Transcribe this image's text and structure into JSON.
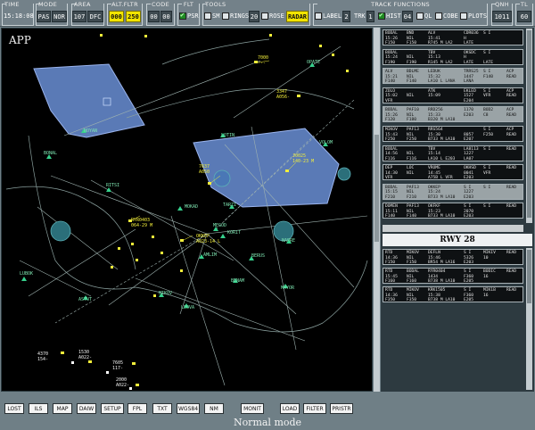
{
  "toolbar": {
    "groups": {
      "time": "TIME",
      "mode": "MODE",
      "area": "AREA",
      "alt_fltr": "ALT.FLTR",
      "code": "CODE",
      "flt": "FLT",
      "tools": "TOOLS",
      "track_functions": "TRACK FUNCTIONS",
      "qnh": "QNH",
      "tl": "TL"
    },
    "time_value": "15:18:08",
    "mode_buttons": [
      "PAS",
      "NOR"
    ],
    "area_values": [
      "107",
      "DFC"
    ],
    "alt_filter": [
      "000",
      "250"
    ],
    "code_values": [
      "00",
      "00"
    ],
    "flt_psr": "PSR",
    "tools": {
      "sm": "SM",
      "rings": "RINGS",
      "rings_value": "20",
      "rose": "ROSE",
      "radar": "RADAR"
    },
    "track": {
      "label": "LABEL",
      "label_value": "2",
      "trk": "TRK",
      "trk_value": "1",
      "hist": "HIST",
      "hist_value": "04",
      "ql": "QL",
      "cobe": "COBE",
      "plots": "PLOTS"
    },
    "qnh_value": "1011",
    "tl_value": "60"
  },
  "radar": {
    "title": "APP",
    "fixes": [
      "NOYAN",
      "BONAL",
      "RITSI",
      "MOKAD",
      "MEGOD",
      "KORIT",
      "AMLIM",
      "BERUS",
      "BENAM",
      "MAYOR",
      "LEOVA",
      "MIKOV",
      "ASTUT",
      "LUBOK",
      "LOTIN",
      "VOLOM",
      "TARZI",
      "NAPRE",
      "OPATE"
    ],
    "data_tags": [
      {
        "text": "7000\n---",
        "color": "yellow"
      },
      {
        "text": "3347\nA056-",
        "color": "yellow"
      },
      {
        "text": "J0025\n140-23 M",
        "color": "yellow"
      },
      {
        "text": "7637\nA050",
        "color": "yellow"
      },
      {
        "text": "RYR0403\n064-29 M",
        "color": "yellow"
      },
      {
        "text": "OKKEP\nA023-14 L",
        "color": "yellow"
      },
      {
        "text": "4370\n154-",
        "color": "yellow"
      },
      {
        "text": "1530\nA022-",
        "color": "yellow"
      },
      {
        "text": "7605\n117-",
        "color": "yellow"
      },
      {
        "text": "2000\nA022-",
        "color": "yellow"
      }
    ]
  },
  "strips": {
    "departures": [
      {
        "c1": "BODAL\n15:26\nF150",
        "c2": "BND\nNIL\nF150",
        "c3": "ALV\n15:41\nR745 M LA2",
        "c4": "CDR036\nH\nLATE",
        "c5": "S I\n\n ",
        "grey": false
      },
      {
        "c1": "BODAL\n15:24\nF190",
        "c2": "\nNIL\nF190",
        "c3": "TBV\n15:13\nR145 M LA2",
        "c4": "OKSDC\nH\nLATE",
        "c5": "S I\n\nLATE",
        "grey": false
      },
      {
        "c1": "ALV\n15:21\nF140",
        "c2": "BDLME\nNIL\nF140",
        "c3": "LEDUK\n15:32\nLA10 L LANA",
        "c4": "TRRS25\n1447\nLANA",
        "c5": "S I\nF140\n ",
        "act": "ACP\nREAD",
        "grey": true
      },
      {
        "c1": "ZOLO\n15:02\nVFR",
        "c2": "\nNIL\n ",
        "c3": "ATK\n15:09\n ",
        "c4": "EKLED\n1527\nE204",
        "c5": "S I\nVFR\n ",
        "act": "ACP\nREAD",
        "grey": false
      },
      {
        "c1": "BODAL\n15:26\nF120",
        "c2": "PAF10\nNIL\nF180",
        "c3": "RRD256\n15:33\nB320 M LA10",
        "c4": "1170\nE203",
        "c5": "BOD2\nC8\n ",
        "act": "ACP\nREAD",
        "grey": true
      },
      {
        "c1": "MIKOV\n15:43\nF250",
        "c2": "PAF13\nNIL\nF250",
        "c3": "RRS564\n15:30\nB733 M LA10",
        "c4": "\n8057\nE207",
        "c5": "S I\nF250\n ",
        "act": "ACP\nREAD",
        "grey": false
      },
      {
        "c1": "BODAL\n14:56\nF116",
        "c2": "\nNIL\nF116",
        "c3": "TBV\n15:14\nLA10 L E203",
        "c4": "LA8113\n1227\nLA07",
        "c5": "S I\n\n ",
        "act": "READ",
        "grey": false
      },
      {
        "c1": "DEP\n14:30\nVFR",
        "c2": "LOC\nNIL\n ",
        "c3": "VROME\n14:45\nA75B L VFR",
        "c4": "OKHSD\n0041\nE203",
        "c5": "S I\nVFR\n ",
        "act": "READ",
        "grey": false
      },
      {
        "c1": "BODAL\n15:15\nF210",
        "c2": "PAF13\nNIL\nF210",
        "c3": "OKKEP\n15:24\nB733 M LA10",
        "c4": "S I\n1227\nE203",
        "c5": "S I\n\n ",
        "act": "READ",
        "grey": true
      },
      {
        "c1": "DOMEN\n15:11\nF140",
        "c2": "PAF13\nNIL\nF140",
        "c3": "OKFKF\n15:23\nB733 M LA10",
        "c4": "S I\n2070\nE203",
        "c5": "S I\n\n ",
        "act": "READ",
        "grey": false
      }
    ],
    "runway_label": "RWY 28",
    "arrivals": [
      {
        "c1": "RTD\n14:36\nF150",
        "c2": "MIKOV\nNIL\nF150",
        "c3": "DEFLN\n15:46\nBR54 M LA16",
        "c4": "S I\n5326\nE203",
        "c5": "MIKIV\n10\n ",
        "act": "READ"
      },
      {
        "c1": "RTD\n15:45\nF160",
        "c2": "BODAL\nNIL\nF160",
        "c3": "RYR0404\n1434\nB738 M LA10",
        "c4": "S I\nF360\nE205",
        "c5": "BODIC\n16\n ",
        "act": "READ"
      },
      {
        "c1": "RTD\n14:36\nF350",
        "c2": "MIKOV\nNIL\nF350",
        "c3": "KRK1505\n15:38\nB738 M LA10",
        "c4": "S I\nF360\nE205",
        "c5": "MIK1B\n16\n ",
        "act": "READ"
      }
    ]
  },
  "bottom": {
    "buttons": [
      "LOST",
      "ILS",
      "MAP",
      "DAIW",
      "SETUP",
      "FPL",
      "TXT",
      "WGS84",
      "NM",
      "MONIT",
      "LOAD",
      "FILTER",
      "PRISTR"
    ],
    "mode_text": "Normal mode"
  },
  "colors": {
    "airspace": "#6a8fd6",
    "map_lines": "#9fb3b0",
    "fixes": "#36d08c",
    "tags": "#f2ee3a"
  }
}
